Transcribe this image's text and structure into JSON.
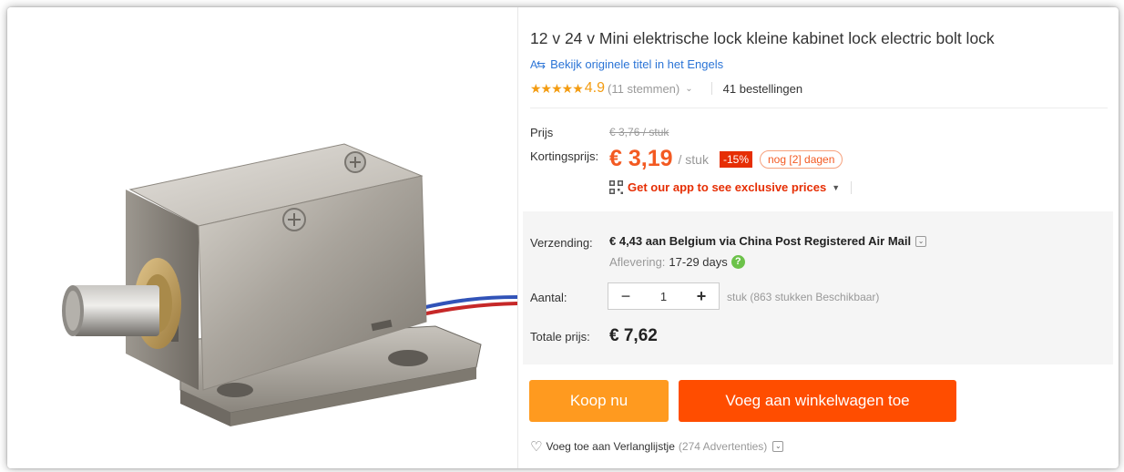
{
  "product": {
    "title": "12 v 24 v Mini elektrische lock kleine kabinet lock electric bolt lock",
    "original_title_link": "Bekijk originele titel in het Engels",
    "translate_icon": "translate-icon",
    "rating": {
      "stars": "★★★★★",
      "score": "4.9",
      "votes": "(11 stemmen)",
      "orders": "41 bestellingen"
    }
  },
  "pricing": {
    "price_label": "Prijs",
    "old_price": "€ 3,76 / stuk",
    "discount_label": "Kortingsprijs:",
    "price": "€ 3,19",
    "unit": "/ stuk",
    "discount_badge": "-15%",
    "days_badge": "nog [2] dagen",
    "app_promo": "Get our app to see exclusive prices"
  },
  "shipping": {
    "label": "Verzending:",
    "value": "€ 4,43 aan Belgium via China Post Registered Air Mail",
    "delivery_label": "Aflevering:",
    "delivery_value": "17-29 days"
  },
  "quantity": {
    "label": "Aantal:",
    "minus": "−",
    "value": "1",
    "plus": "+",
    "availability": "stuk (863 stukken Beschikbaar)"
  },
  "total": {
    "label": "Totale prijs:",
    "value": "€ 7,62"
  },
  "actions": {
    "buy_now": "Koop nu",
    "add_to_cart": "Voeg aan winkelwagen toe"
  },
  "wishlist": {
    "label": "Voeg toe aan Verlanglijstje",
    "count": "(274 Advertenties)"
  },
  "colors": {
    "price": "#f35a22",
    "buy_now": "#ff9a1f",
    "add_to_cart": "#ff4d00",
    "stars": "#f39c12",
    "link": "#2b74d6"
  }
}
